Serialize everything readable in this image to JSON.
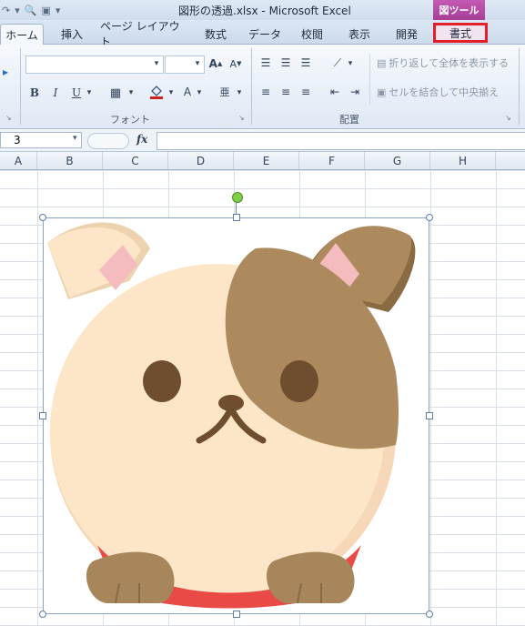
{
  "window": {
    "title": "図形の透過.xlsx - Microsoft Excel",
    "contextual_group": "図ツール"
  },
  "tabs": [
    {
      "label": "ホーム",
      "active": true
    },
    {
      "label": "挿入"
    },
    {
      "label": "ページ レイアウト"
    },
    {
      "label": "数式"
    },
    {
      "label": "データ"
    },
    {
      "label": "校閲"
    },
    {
      "label": "表示"
    },
    {
      "label": "開発"
    }
  ],
  "context_tab": {
    "label": "書式",
    "highlight_color": "#e3202a"
  },
  "ribbon": {
    "font_group": "フォント",
    "align_group": "配置",
    "wrap_text": "折り返して全体を表示する",
    "merge_center": "セルを結合して中央揃え"
  },
  "formula_bar": {
    "name_box": "3",
    "fx_label": "fx",
    "formula": ""
  },
  "columns": [
    "A",
    "B",
    "C",
    "D",
    "E",
    "F",
    "G",
    "H"
  ],
  "picture": {
    "description_icon": "puppy-image",
    "colors": {
      "face": "#fde6c8",
      "patch": "#ad8a5e",
      "eye": "#6e4e2e",
      "ear_inner": "#f5bcc0",
      "collar": "#e94a46",
      "paw": "#a7865b",
      "rotation_handle": "#7fd048"
    }
  }
}
